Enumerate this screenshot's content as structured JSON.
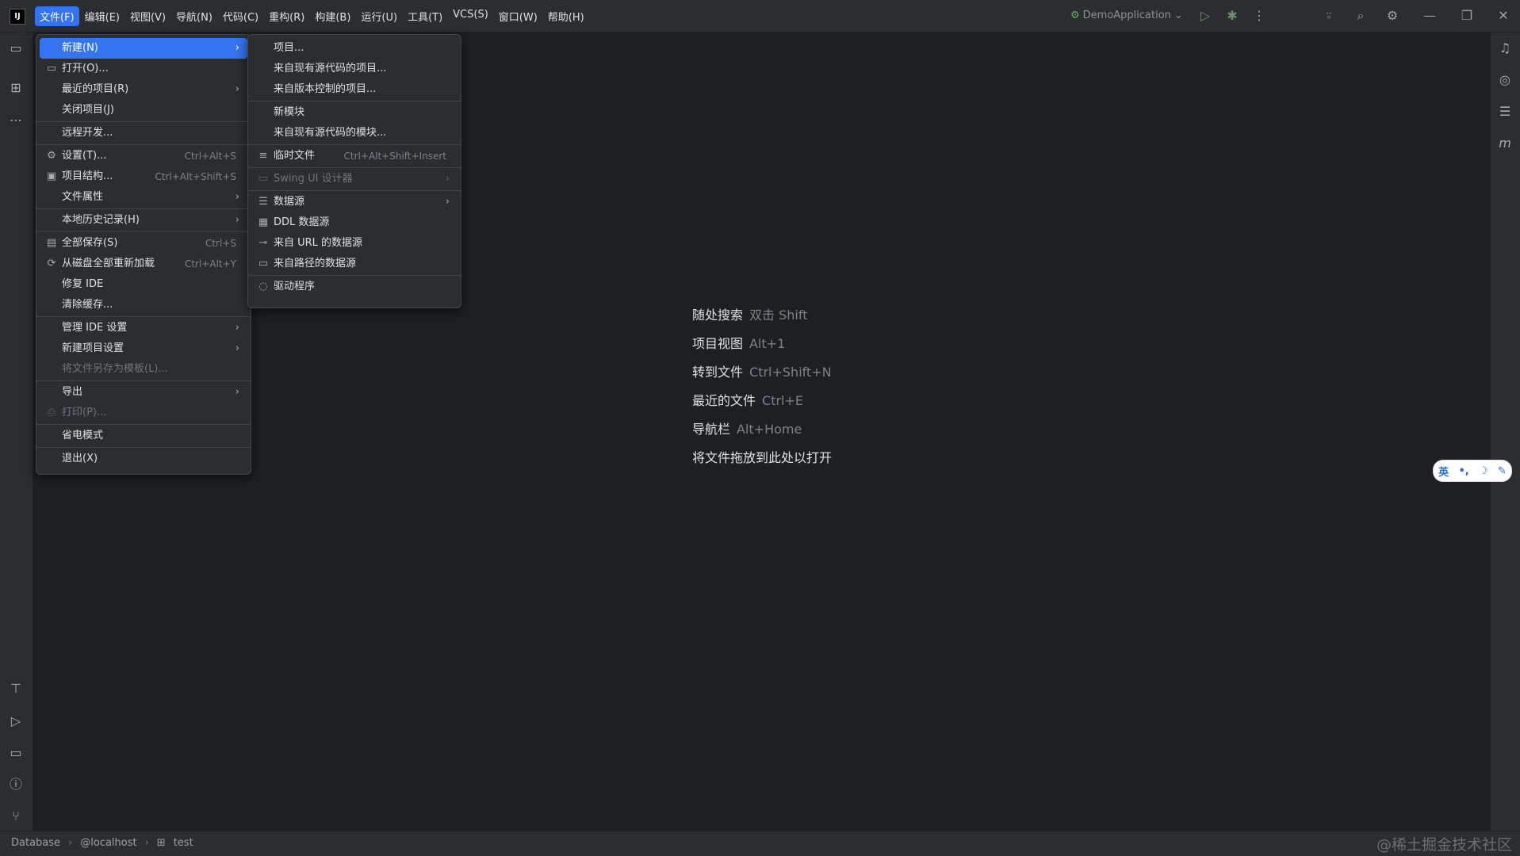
{
  "titlebar": {
    "menus": [
      {
        "label": "文件(F)",
        "active": true
      },
      {
        "label": "编辑(E)"
      },
      {
        "label": "视图(V)"
      },
      {
        "label": "导航(N)"
      },
      {
        "label": "代码(C)"
      },
      {
        "label": "重构(R)"
      },
      {
        "label": "构建(B)"
      },
      {
        "label": "运行(U)"
      },
      {
        "label": "工具(T)"
      },
      {
        "label": "VCS(S)"
      },
      {
        "label": "窗口(W)"
      },
      {
        "label": "帮助(H)"
      }
    ],
    "run_config": "DemoApplication",
    "logo_text": "IJ"
  },
  "file_menu": [
    {
      "label": "新建(N)",
      "arrow": true,
      "selected": true
    },
    {
      "label": "打开(O)...",
      "icon": "folder-icon"
    },
    {
      "label": "最近的项目(R)",
      "arrow": true
    },
    {
      "label": "关闭项目(J)"
    },
    {
      "sep": true
    },
    {
      "label": "远程开发..."
    },
    {
      "sep": true
    },
    {
      "label": "设置(T)...",
      "icon": "gear-icon",
      "shortcut": "Ctrl+Alt+S"
    },
    {
      "label": "项目结构...",
      "icon": "project-structure-icon",
      "shortcut": "Ctrl+Alt+Shift+S"
    },
    {
      "label": "文件属性",
      "arrow": true
    },
    {
      "sep": true
    },
    {
      "label": "本地历史记录(H)",
      "arrow": true
    },
    {
      "sep": true
    },
    {
      "label": "全部保存(S)",
      "icon": "save-icon",
      "shortcut": "Ctrl+S"
    },
    {
      "label": "从磁盘全部重新加载",
      "icon": "reload-icon",
      "shortcut": "Ctrl+Alt+Y"
    },
    {
      "label": "修复 IDE"
    },
    {
      "label": "清除缓存..."
    },
    {
      "sep": true
    },
    {
      "label": "管理 IDE 设置",
      "arrow": true
    },
    {
      "label": "新建项目设置",
      "arrow": true
    },
    {
      "label": "将文件另存为模板(L)...",
      "disabled": true
    },
    {
      "sep": true
    },
    {
      "label": "导出",
      "arrow": true
    },
    {
      "label": "打印(P)...",
      "icon": "print-icon",
      "disabled": true
    },
    {
      "sep": true
    },
    {
      "label": "省电模式"
    },
    {
      "sep": true
    },
    {
      "label": "退出(X)"
    }
  ],
  "new_submenu": [
    {
      "label": "项目..."
    },
    {
      "label": "来自现有源代码的项目..."
    },
    {
      "label": "来自版本控制的项目..."
    },
    {
      "sep": true
    },
    {
      "label": "新模块"
    },
    {
      "label": "来自现有源代码的模块..."
    },
    {
      "sep": true
    },
    {
      "label": "临时文件",
      "icon": "scratch-file-icon",
      "shortcut": "Ctrl+Alt+Shift+Insert"
    },
    {
      "sep": true
    },
    {
      "label": "Swing UI 设计器",
      "icon": "swing-designer-icon",
      "arrow": true,
      "disabled": true
    },
    {
      "sep": true
    },
    {
      "label": "数据源",
      "icon": "database-icon",
      "arrow": true
    },
    {
      "label": "DDL 数据源",
      "icon": "ddl-datasource-icon"
    },
    {
      "label": "来自 URL 的数据源",
      "icon": "url-datasource-icon"
    },
    {
      "label": "来自路径的数据源",
      "icon": "folder-icon"
    },
    {
      "sep": true
    },
    {
      "label": "驱动程序",
      "icon": "driver-icon"
    }
  ],
  "hints": [
    {
      "label": "随处搜索",
      "key": "双击 Shift"
    },
    {
      "label": "项目视图",
      "key": "Alt+1"
    },
    {
      "label": "转到文件",
      "key": "Ctrl+Shift+N"
    },
    {
      "label": "最近的文件",
      "key": "Ctrl+E"
    },
    {
      "label": "导航栏",
      "key": "Alt+Home"
    },
    {
      "label": "将文件拖放到此处以打开",
      "key": ""
    }
  ],
  "statusbar": {
    "breadcrumb": [
      "Database",
      "@localhost",
      "test"
    ],
    "watermark": "@稀土掘金技术社区"
  },
  "ime": {
    "lang": "英",
    "punct": "•,",
    "moon": "☽",
    "tool": "✎"
  },
  "icons": {
    "folder-icon": "▭",
    "gear-icon": "⚙",
    "project-structure-icon": "▣",
    "save-icon": "▤",
    "reload-icon": "⟳",
    "print-icon": "⎙",
    "scratch-file-icon": "≡",
    "swing-designer-icon": "▭",
    "database-icon": "☰",
    "ddl-datasource-icon": "▦",
    "url-datasource-icon": "⊸",
    "driver-icon": "◌"
  }
}
